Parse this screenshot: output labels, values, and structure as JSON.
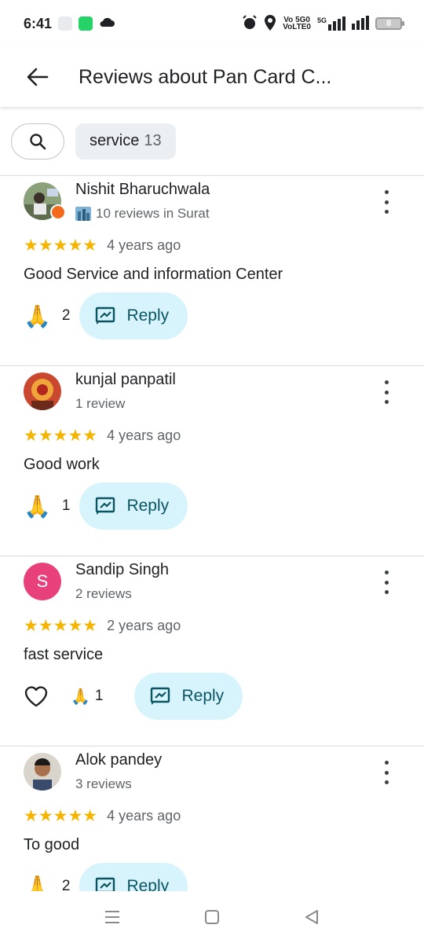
{
  "status": {
    "time": "6:41",
    "net1": "Vo 5G0",
    "net1b": "VoLTE0",
    "net2": "5G",
    "battery": "8"
  },
  "header": {
    "title": "Reviews about Pan Card C..."
  },
  "filters": {
    "chip_label": "service",
    "chip_count": "13"
  },
  "reviews": [
    {
      "name": "Nishit Bharuchwala",
      "meta": "10 reviews in Surat",
      "stars": "★★★★★",
      "date": "4 years ago",
      "text": "Good Service and information Center",
      "emoji": "🙏",
      "count": "2",
      "reply": "Reply"
    },
    {
      "name": "kunjal panpatil",
      "meta": "1 review",
      "stars": "★★★★★",
      "date": "4 years ago",
      "text": "Good work",
      "emoji": "🙏",
      "count": "1",
      "reply": "Reply"
    },
    {
      "name": "Sandip Singh",
      "avatar_letter": "S",
      "meta": "2 reviews",
      "stars": "★★★★★",
      "date": "2 years ago",
      "text": "fast service",
      "emoji": "🙏",
      "count": "1",
      "reply": "Reply"
    },
    {
      "name": "Alok pandey",
      "meta": "3 reviews",
      "stars": "★★★★★",
      "date": "4 years ago",
      "text": "To good",
      "emoji": "🙏",
      "count": "2",
      "reply": "Reply"
    }
  ]
}
